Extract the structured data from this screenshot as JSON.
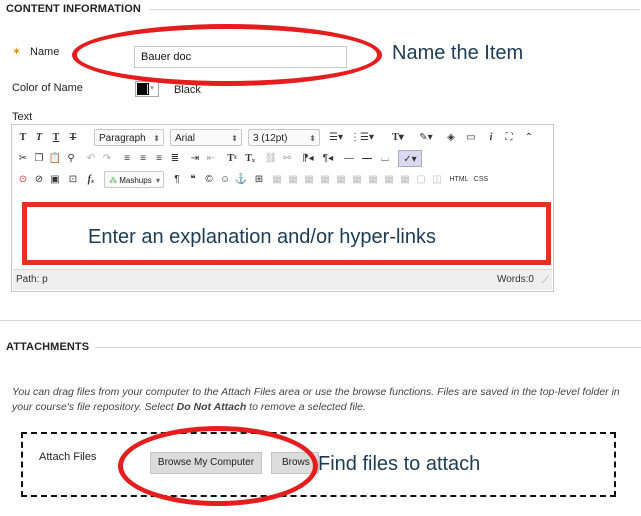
{
  "content": {
    "section_title": "CONTENT INFORMATION",
    "name_label": "Name",
    "name_value": "Bauer doc",
    "name_callout": "Name the Item",
    "color_label": "Color of Name",
    "color_value": "Black",
    "text_label": "Text",
    "editor": {
      "format_select": "Paragraph",
      "font_select": "Arial",
      "size_select": "3 (12pt)",
      "mashups": "Mashups",
      "html_btn": "HTML",
      "css_btn": "CSS",
      "body_callout": "Enter an explanation and/or hyper-links",
      "path_label": "Path: p",
      "words_label": "Words:0"
    }
  },
  "attachments": {
    "section_title": "ATTACHMENTS",
    "description_line1": "You can drag files from your computer to the Attach Files area or use the browse functions. Files are saved in the top-level folder in",
    "description_line2_pre": "your course's file repository.  Select ",
    "description_bold": "Do Not Attach",
    "description_line2_post": " to remove a selected file.",
    "attach_label": "Attach Files",
    "browse_computer": "Browse My Computer",
    "browse_partial": "Brows",
    "files_callout": "Find files to attach"
  },
  "colors": {
    "annotation_red": "#e41e1e",
    "callout_text": "#1c3b55",
    "required_star": "#e08a00"
  }
}
